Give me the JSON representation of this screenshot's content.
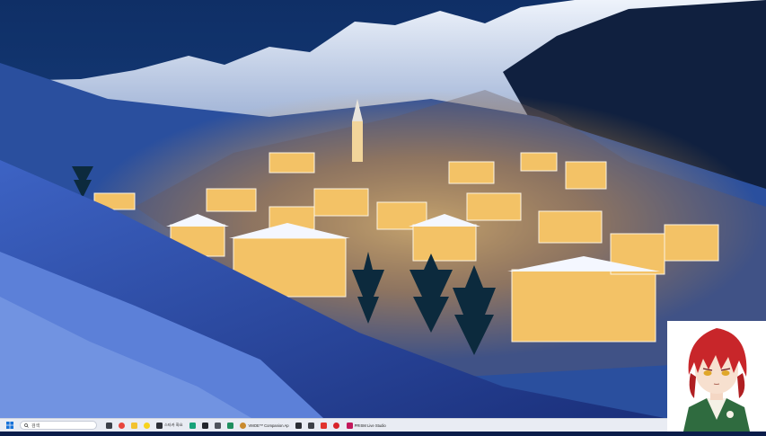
{
  "taskbar": {
    "search_placeholder": "검색",
    "apps": [
      {
        "name": "task-view",
        "color": "#3b3f48"
      },
      {
        "name": "chrome",
        "color": "#e8453c"
      },
      {
        "name": "file-explorer",
        "color": "#f2c230"
      },
      {
        "name": "kakaotalk",
        "color": "#f7d31c"
      },
      {
        "name": "app-5",
        "color": "#2c2f36",
        "label": "스타카 화요"
      },
      {
        "name": "app-6",
        "color": "#17a37a"
      },
      {
        "name": "app-7",
        "color": "#23262d"
      },
      {
        "name": "app-8",
        "color": "#4f535c"
      },
      {
        "name": "app-9",
        "color": "#1f8f5f"
      },
      {
        "name": "companion",
        "color": "#c98a2e",
        "label": "VMOE™ Companion Ap"
      },
      {
        "name": "app-11",
        "color": "#2b2d33"
      },
      {
        "name": "app-12",
        "color": "#3d4047"
      },
      {
        "name": "app-13",
        "color": "#e1332e"
      },
      {
        "name": "app-14",
        "color": "#d8242a"
      },
      {
        "name": "prism",
        "color": "#c2185b",
        "label": "PRISM Live Studio"
      }
    ]
  },
  "avatar": {
    "hair": "#c8262a",
    "eyes": "#e0a72a",
    "jacket": "#2f6b3f"
  }
}
